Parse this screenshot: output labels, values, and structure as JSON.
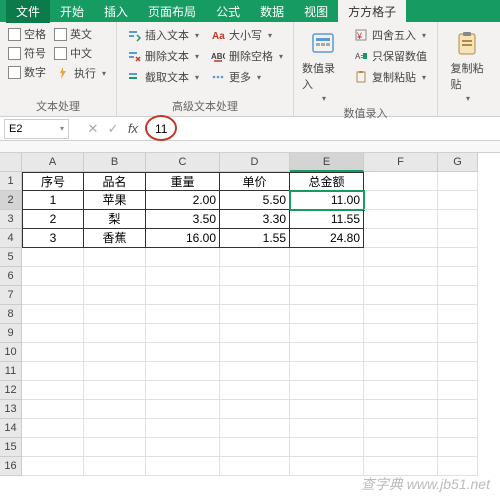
{
  "titlebar": {
    "file": "文件",
    "tabs": [
      "开始",
      "插入",
      "页面布局",
      "公式",
      "数据",
      "视图",
      "方方格子"
    ],
    "active_tab": "方方格子"
  },
  "ribbon": {
    "group1": {
      "label": "文本处理",
      "checks": [
        "空格",
        "英文",
        "符号",
        "中文",
        "数字",
        "执行"
      ]
    },
    "group2": {
      "label": "高级文本处理",
      "col1": [
        "插入文本",
        "删除文本",
        "截取文本"
      ],
      "col2": [
        "大小写",
        "删除空格",
        "更多"
      ]
    },
    "group3": {
      "label": "数值录入",
      "big": "数值录入",
      "items": [
        "四舍五入",
        "只保留数值",
        "复制粘贴"
      ]
    }
  },
  "formula": {
    "namebox": "E2",
    "value": "11"
  },
  "sheet": {
    "cols": [
      "A",
      "B",
      "C",
      "D",
      "E",
      "F",
      "G"
    ],
    "active_col": "E",
    "active_row": 2,
    "headers": [
      "序号",
      "品名",
      "重量",
      "单价",
      "总金额"
    ],
    "rows": [
      [
        "1",
        "苹果",
        "2.00",
        "5.50",
        "11.00"
      ],
      [
        "2",
        "梨",
        "3.50",
        "3.30",
        "11.55"
      ],
      [
        "3",
        "香蕉",
        "16.00",
        "1.55",
        "24.80"
      ]
    ],
    "row_count": 16
  },
  "watermark": "查字典 www.jb51.net",
  "chart_data": {
    "type": "table",
    "title": "",
    "columns": [
      "序号",
      "品名",
      "重量",
      "单价",
      "总金额"
    ],
    "data": [
      {
        "序号": 1,
        "品名": "苹果",
        "重量": 2.0,
        "单价": 5.5,
        "总金额": 11.0
      },
      {
        "序号": 2,
        "品名": "梨",
        "重量": 3.5,
        "单价": 3.3,
        "总金额": 11.55
      },
      {
        "序号": 3,
        "品名": "香蕉",
        "重量": 16.0,
        "单价": 1.55,
        "总金额": 24.8
      }
    ]
  }
}
